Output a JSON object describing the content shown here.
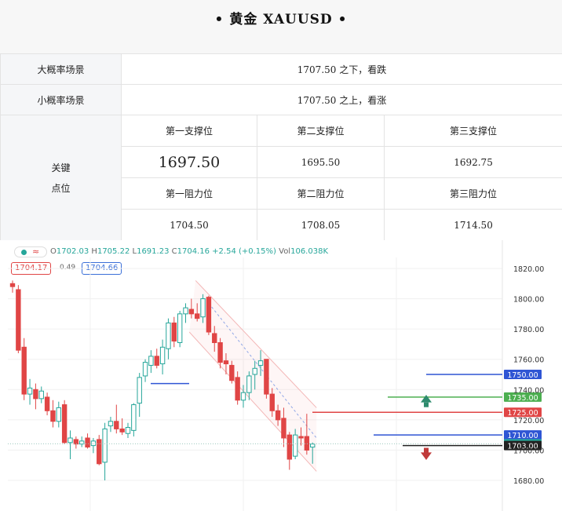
{
  "header": {
    "title": "•  黄金 XAUUSD  •"
  },
  "table": {
    "big_scenario_label": "大概率场景",
    "big_scenario_value": "1707.50 之下，看跌",
    "small_scenario_label": "小概率场景",
    "small_scenario_value": "1707.50 之上，看涨",
    "key_label_line1": "关键",
    "key_label_line2": "点位",
    "support1_label": "第一支撑位",
    "support2_label": "第二支撑位",
    "support3_label": "第三支撑位",
    "support1_value": "1697.50",
    "support2_value": "1695.50",
    "support3_value": "1692.75",
    "resist1_label": "第一阻力位",
    "resist2_label": "第二阻力位",
    "resist3_label": "第三阻力位",
    "resist1_value": "1704.50",
    "resist2_value": "1708.05",
    "resist3_value": "1714.50"
  },
  "quote_bar": {
    "toggle_icon": "≈",
    "o_label": "O",
    "o": "1702.03",
    "h_label": "H",
    "h": "1705.22",
    "l_label": "L",
    "l": "1691.23",
    "c_label": "C",
    "c": "1704.16",
    "change": "+2.54 (+0.15%)",
    "vol_label": "Vol",
    "vol": "106.038K",
    "sell_price": "1704.17",
    "spread": "0.49",
    "buy_price": "1704.66"
  },
  "colors": {
    "up": "#26a69a",
    "down": "#e04545",
    "level_blue": "#2f55d4",
    "level_green": "#4caf50",
    "level_red": "#e04545",
    "level_black": "#222222",
    "channel": "#f3b7b7"
  },
  "chart_data": {
    "type": "candlestick",
    "ylim": [
      1675,
      1830
    ],
    "y_ticks": [
      "1820.00",
      "1800.00",
      "1780.00",
      "1760.00",
      "1740.00",
      "1720.00",
      "1700.00",
      "1680.00"
    ],
    "y_tick_values": [
      1820,
      1800,
      1780,
      1760,
      1740,
      1720,
      1700,
      1680
    ],
    "candles": [
      {
        "o": 1810,
        "h": 1812,
        "l": 1804,
        "c": 1808
      },
      {
        "o": 1806,
        "h": 1809,
        "l": 1764,
        "c": 1766
      },
      {
        "o": 1768,
        "h": 1774,
        "l": 1733,
        "c": 1737
      },
      {
        "o": 1737,
        "h": 1747,
        "l": 1730,
        "c": 1741
      },
      {
        "o": 1740,
        "h": 1744,
        "l": 1727,
        "c": 1734
      },
      {
        "o": 1734,
        "h": 1742,
        "l": 1731,
        "c": 1739
      },
      {
        "o": 1735,
        "h": 1738,
        "l": 1723,
        "c": 1726
      },
      {
        "o": 1726,
        "h": 1733,
        "l": 1715,
        "c": 1719
      },
      {
        "o": 1719,
        "h": 1732,
        "l": 1715,
        "c": 1728
      },
      {
        "o": 1730,
        "h": 1733,
        "l": 1704,
        "c": 1705
      },
      {
        "o": 1705,
        "h": 1713,
        "l": 1694,
        "c": 1708
      },
      {
        "o": 1707,
        "h": 1709,
        "l": 1701,
        "c": 1704
      },
      {
        "o": 1704,
        "h": 1709,
        "l": 1702,
        "c": 1706
      },
      {
        "o": 1708,
        "h": 1711,
        "l": 1701,
        "c": 1702
      },
      {
        "o": 1703,
        "h": 1708,
        "l": 1698,
        "c": 1706
      },
      {
        "o": 1707,
        "h": 1710,
        "l": 1690,
        "c": 1691
      },
      {
        "o": 1692,
        "h": 1718,
        "l": 1680,
        "c": 1714
      },
      {
        "o": 1716,
        "h": 1722,
        "l": 1712,
        "c": 1719
      },
      {
        "o": 1719,
        "h": 1730,
        "l": 1711,
        "c": 1714
      },
      {
        "o": 1714,
        "h": 1721,
        "l": 1710,
        "c": 1712
      },
      {
        "o": 1711,
        "h": 1718,
        "l": 1708,
        "c": 1715
      },
      {
        "o": 1713,
        "h": 1731,
        "l": 1709,
        "c": 1730
      },
      {
        "o": 1731,
        "h": 1751,
        "l": 1722,
        "c": 1748
      },
      {
        "o": 1749,
        "h": 1760,
        "l": 1745,
        "c": 1758
      },
      {
        "o": 1756,
        "h": 1766,
        "l": 1751,
        "c": 1762
      },
      {
        "o": 1762,
        "h": 1767,
        "l": 1754,
        "c": 1756
      },
      {
        "o": 1757,
        "h": 1773,
        "l": 1750,
        "c": 1768
      },
      {
        "o": 1767,
        "h": 1787,
        "l": 1760,
        "c": 1784
      },
      {
        "o": 1784,
        "h": 1788,
        "l": 1768,
        "c": 1772
      },
      {
        "o": 1771,
        "h": 1792,
        "l": 1768,
        "c": 1790
      },
      {
        "o": 1790,
        "h": 1797,
        "l": 1784,
        "c": 1794
      },
      {
        "o": 1793,
        "h": 1800,
        "l": 1787,
        "c": 1790
      },
      {
        "o": 1790,
        "h": 1797,
        "l": 1785,
        "c": 1787
      },
      {
        "o": 1788,
        "h": 1803,
        "l": 1784,
        "c": 1800
      },
      {
        "o": 1801,
        "h": 1802,
        "l": 1776,
        "c": 1778
      },
      {
        "o": 1777,
        "h": 1782,
        "l": 1765,
        "c": 1771
      },
      {
        "o": 1771,
        "h": 1774,
        "l": 1754,
        "c": 1758
      },
      {
        "o": 1759,
        "h": 1764,
        "l": 1750,
        "c": 1757
      },
      {
        "o": 1756,
        "h": 1759,
        "l": 1744,
        "c": 1746
      },
      {
        "o": 1748,
        "h": 1752,
        "l": 1730,
        "c": 1733
      },
      {
        "o": 1733,
        "h": 1743,
        "l": 1728,
        "c": 1738
      },
      {
        "o": 1738,
        "h": 1752,
        "l": 1733,
        "c": 1749
      },
      {
        "o": 1750,
        "h": 1759,
        "l": 1740,
        "c": 1754
      },
      {
        "o": 1756,
        "h": 1766,
        "l": 1749,
        "c": 1759
      },
      {
        "o": 1760,
        "h": 1760,
        "l": 1734,
        "c": 1737
      },
      {
        "o": 1737,
        "h": 1741,
        "l": 1722,
        "c": 1726
      },
      {
        "o": 1726,
        "h": 1730,
        "l": 1716,
        "c": 1720
      },
      {
        "o": 1721,
        "h": 1728,
        "l": 1702,
        "c": 1708
      },
      {
        "o": 1710,
        "h": 1712,
        "l": 1687,
        "c": 1694
      },
      {
        "o": 1696,
        "h": 1714,
        "l": 1694,
        "c": 1710
      },
      {
        "o": 1709,
        "h": 1715,
        "l": 1703,
        "c": 1708
      },
      {
        "o": 1709,
        "h": 1724,
        "l": 1697,
        "c": 1700
      },
      {
        "o": 1702,
        "h": 1705,
        "l": 1691,
        "c": 1704
      }
    ],
    "levels": [
      {
        "value": 1750.0,
        "label": "1750.00",
        "color": "blue"
      },
      {
        "value": 1735.0,
        "label": "1735.00",
        "color": "green"
      },
      {
        "value": 1725.0,
        "label": "1725.00",
        "color": "red"
      },
      {
        "value": 1710.0,
        "label": "1710.00",
        "color": "blue"
      },
      {
        "value": 1704.16,
        "label": "1704.16",
        "color": "teal"
      },
      {
        "value": 1703.0,
        "label": "1703.00",
        "color": "black"
      }
    ]
  }
}
